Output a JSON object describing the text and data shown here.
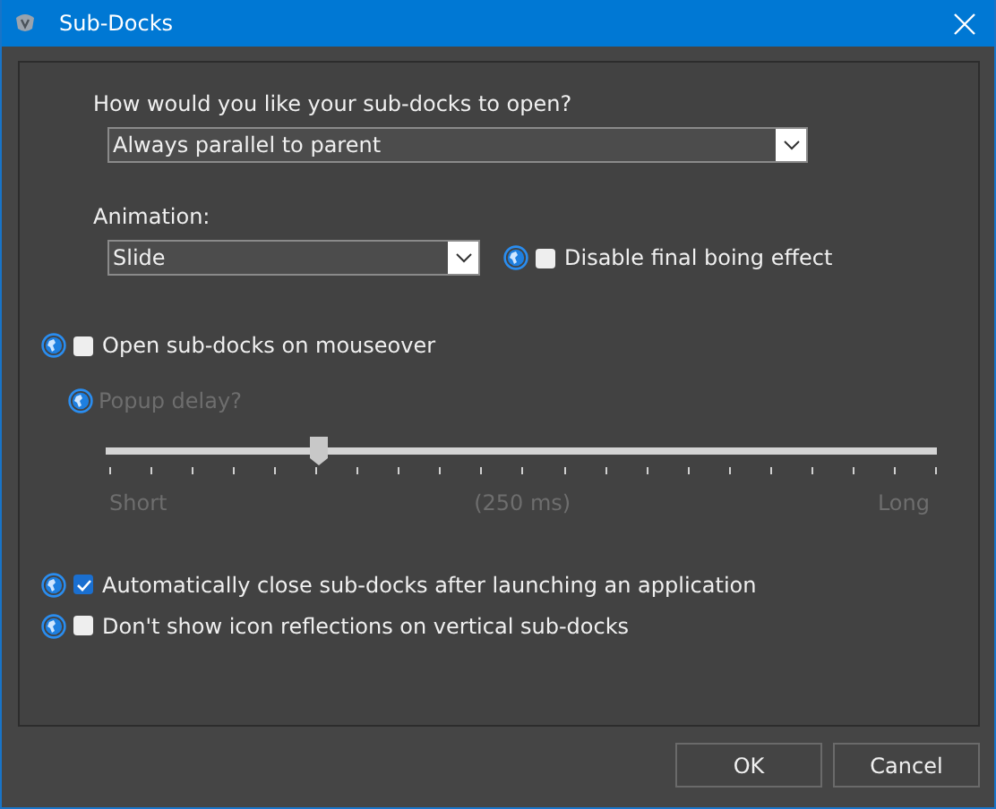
{
  "window": {
    "title": "Sub-Docks"
  },
  "open_style": {
    "label": "How would you like your sub-docks to open?",
    "value": "Always parallel to parent"
  },
  "animation": {
    "label": "Animation:",
    "value": "Slide",
    "boing": {
      "label": "Disable final boing effect",
      "checked": false
    }
  },
  "mouseover": {
    "label": "Open sub-docks on mouseover",
    "checked": false
  },
  "popup_delay": {
    "label": "Popup delay?",
    "disabled": true,
    "level": 0.256,
    "min_label": "Short",
    "value_label": "(250 ms)",
    "max_label": "Long"
  },
  "options": [
    {
      "label": "Automatically close sub-docks after launching an application",
      "checked": true
    },
    {
      "label": "Don't show icon reflections on vertical sub-docks",
      "checked": false
    }
  ],
  "buttons": [
    "OK",
    "Cancel"
  ]
}
